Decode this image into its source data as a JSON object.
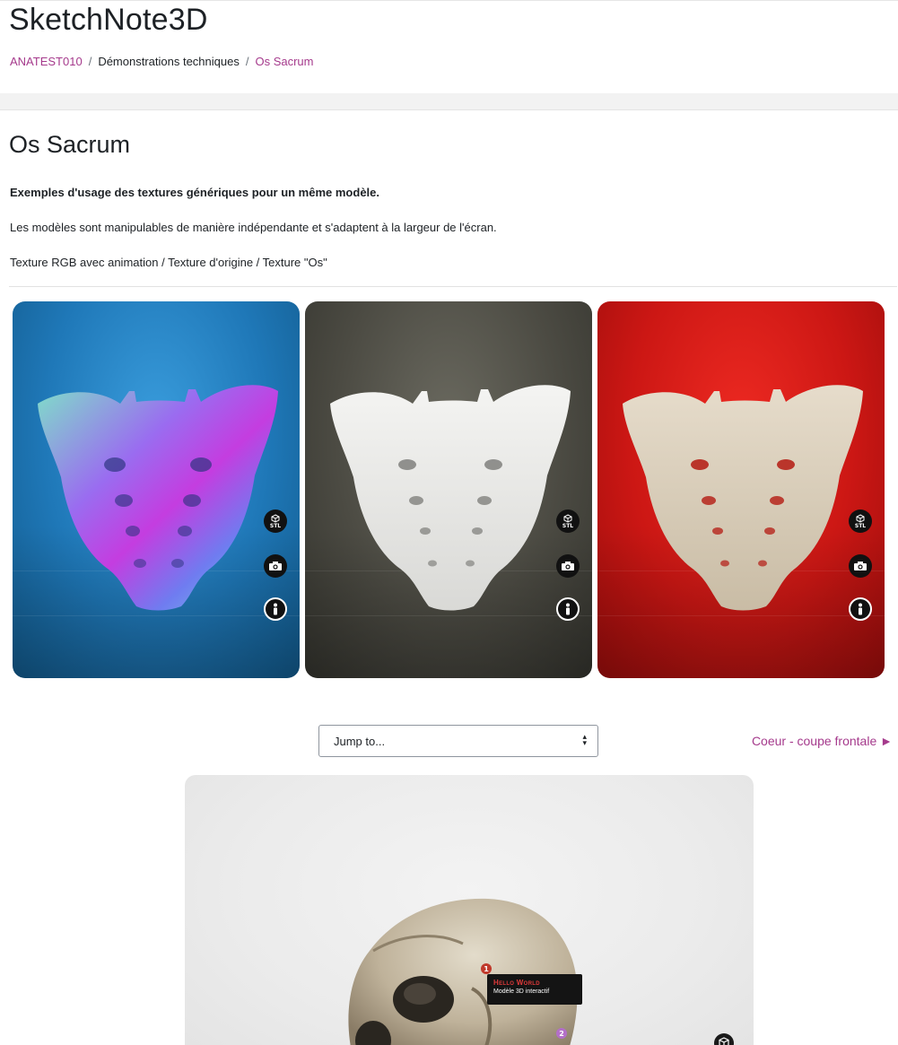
{
  "header": {
    "site_title": "SketchNote3D",
    "breadcrumb": [
      {
        "label": "ANATEST010",
        "is_link": true
      },
      {
        "label": "Démonstrations techniques",
        "is_link": false
      },
      {
        "label": "Os Sacrum",
        "is_link": true
      }
    ],
    "separator": "/"
  },
  "main": {
    "title": "Os Sacrum",
    "subtitle": "Exemples d'usage des textures génériques pour un même modèle.",
    "description": "Les modèles sont manipulables de manière indépendante et s'adaptent à la largeur de l'écran.",
    "texture_list": "Texture RGB avec animation / Texture d'origine / Texture \"Os\""
  },
  "viewers": [
    {
      "background": "#1f78b8",
      "controls": {
        "stl": "STL",
        "camera": "camera-icon",
        "info": "info-icon"
      }
    },
    {
      "background": "#4c4b43",
      "controls": {
        "stl": "STL",
        "camera": "camera-icon",
        "info": "info-icon"
      }
    },
    {
      "background": "#cc1714",
      "controls": {
        "stl": "STL",
        "camera": "camera-icon",
        "info": "info-icon"
      }
    }
  ],
  "navigation": {
    "jump_to_placeholder": "Jump to...",
    "next_link_label": "Coeur - coupe frontale ►"
  },
  "bottom_viewer": {
    "annotation_markers": [
      "1",
      "2"
    ],
    "tooltip_title": "Hello World",
    "tooltip_subtitle": "Modèle 3D interactif"
  },
  "colors": {
    "accent_link": "#a53a8c",
    "text": "#1d2125"
  }
}
